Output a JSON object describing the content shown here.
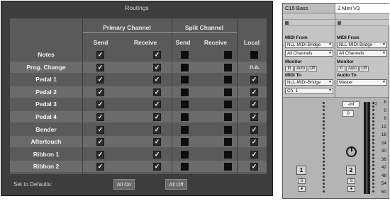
{
  "routings": {
    "title": "Routings",
    "groups": {
      "primary": "Primary Channel",
      "split": "Split Channel"
    },
    "columns": [
      "Send",
      "Receive",
      "Send",
      "Receive",
      "Local"
    ],
    "rows": [
      {
        "label": "Notes",
        "cells": [
          "check",
          "check",
          "square",
          "square",
          "square"
        ]
      },
      {
        "label": "Prog. Change",
        "cells": [
          "check",
          "check",
          "square",
          "square",
          "n.a."
        ]
      },
      {
        "label": "Pedal 1",
        "cells": [
          "check",
          "check",
          "square",
          "square",
          "check"
        ]
      },
      {
        "label": "Pedal 2",
        "cells": [
          "check",
          "check",
          "square",
          "square",
          "check"
        ]
      },
      {
        "label": "Pedal 3",
        "cells": [
          "check",
          "check",
          "square",
          "square",
          "check"
        ]
      },
      {
        "label": "Pedal 4",
        "cells": [
          "check",
          "check",
          "square",
          "square",
          "check"
        ]
      },
      {
        "label": "Bender",
        "cells": [
          "check",
          "check",
          "square",
          "square",
          "check"
        ]
      },
      {
        "label": "Aftertouch",
        "cells": [
          "check",
          "check",
          "square",
          "square",
          "check"
        ]
      },
      {
        "label": "Ribbon 1",
        "cells": [
          "check",
          "check",
          "square",
          "square",
          "check"
        ]
      },
      {
        "label": "Ribbon 2",
        "cells": [
          "check",
          "check",
          "square",
          "square",
          "check"
        ]
      }
    ],
    "defaults_label": "Set to Defaults:",
    "all_on": "All On",
    "all_off": "All Off"
  },
  "tracks": [
    {
      "title": "C15 Bass",
      "midi_from_label": "MIDI From",
      "midi_from": "NLL-MIDI-Bridge",
      "channel_in": "All Channels",
      "monitor_label": "Monitor",
      "monitor_options": [
        "In",
        "Auto",
        "Off"
      ],
      "midi_to_label": "MIDI To",
      "midi_to": "NLL-MIDI-Bridge",
      "channel_out": "Ch. 1",
      "number": "1",
      "solo": "S"
    },
    {
      "title": "2 Mini V3",
      "midi_from_label": "MIDI From",
      "midi_from": "NLL-MIDI-Bridge",
      "channel_in": "All Channels",
      "monitor_label": "Monitor",
      "monitor_options": [
        "In",
        "Auto",
        "Off"
      ],
      "audio_to_label": "Audio To",
      "audio_to": "Master",
      "peak": "-Inf",
      "volume": "0",
      "number": "2",
      "solo": "S",
      "scale": [
        "6",
        "0",
        "6",
        "12",
        "18",
        "24",
        "30",
        "36",
        "42",
        "48",
        "54",
        "60"
      ]
    }
  ],
  "colors": {
    "panel": "#3d3d3d",
    "row_dark": "#5a5a5a",
    "row_light": "#6b6b6b",
    "track_bg": "#c4c4c4"
  }
}
